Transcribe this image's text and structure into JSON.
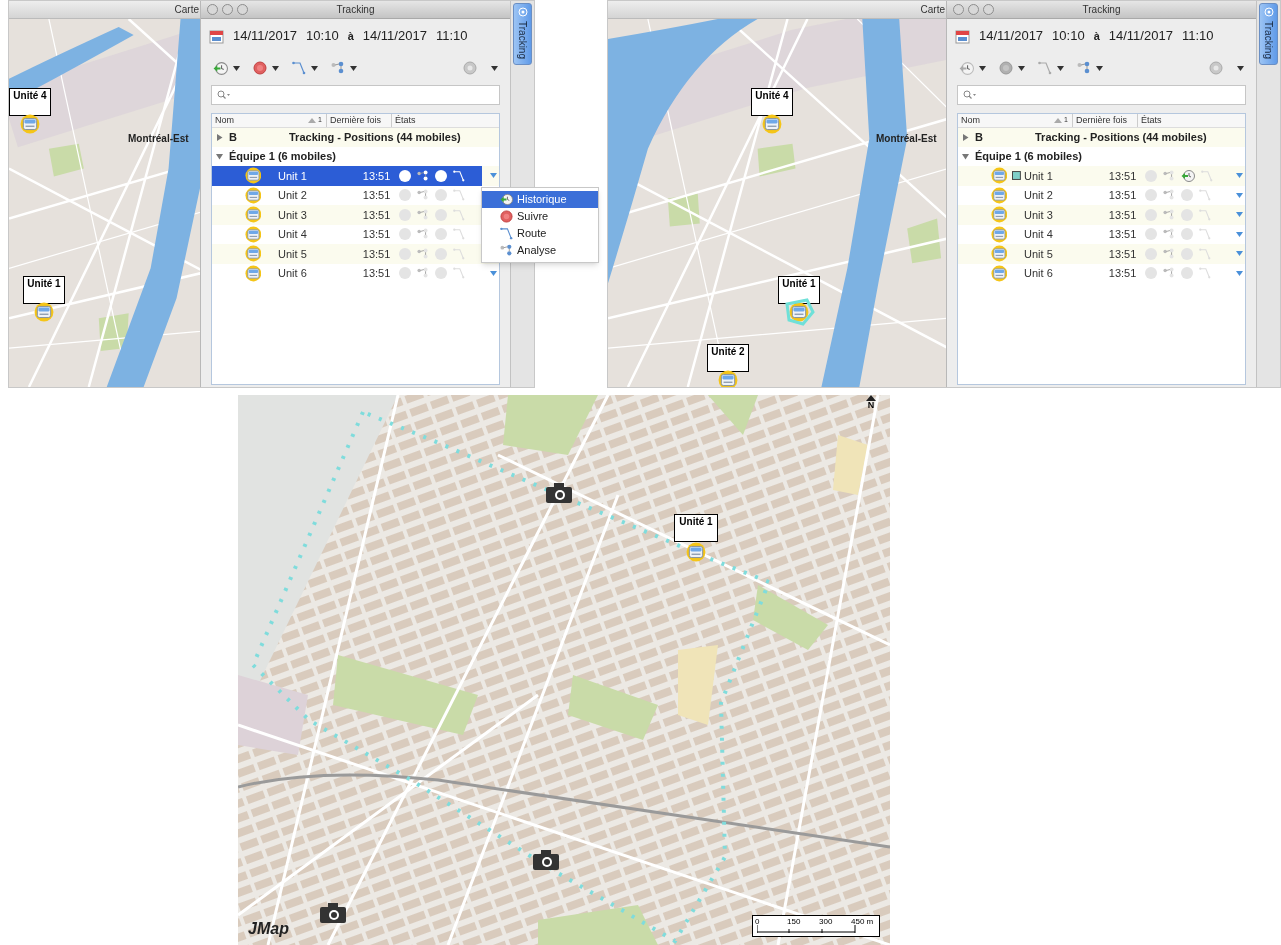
{
  "views": [
    {
      "map": {
        "title": "Carte",
        "place_labels": [
          "Montréal-Est"
        ],
        "markers": [
          {
            "label": "Unité 4",
            "highlighted": false
          },
          {
            "label": "Unité 1",
            "highlighted": false
          }
        ]
      },
      "tracking": {
        "title": "Tracking",
        "date_from": "14/11/2017",
        "time_from": "10:10",
        "separator": "à",
        "date_to": "14/11/2017",
        "time_to": "11:10",
        "toolbar_enabled": true,
        "columns": [
          "Nom",
          "Dernière fois",
          "États"
        ],
        "sort_rank": "1",
        "groups": [
          {
            "code": "B",
            "title": "Tracking - Positions (44 mobiles)",
            "expanded": false
          },
          {
            "title": "Équipe 1 (6 mobiles)",
            "expanded": true,
            "children": [
              {
                "name": "Unit 1",
                "time": "13:51",
                "selected": true,
                "tracked": false,
                "history": false
              },
              {
                "name": "Unit 2",
                "time": "13:51",
                "selected": false,
                "tracked": false,
                "history": false
              },
              {
                "name": "Unit 3",
                "time": "13:51",
                "selected": false,
                "tracked": false,
                "history": false
              },
              {
                "name": "Unit 4",
                "time": "13:51",
                "selected": false,
                "tracked": false,
                "history": false
              },
              {
                "name": "Unit 5",
                "time": "13:51",
                "selected": false,
                "tracked": false,
                "history": false
              },
              {
                "name": "Unit 6",
                "time": "13:51",
                "selected": false,
                "tracked": false,
                "history": false
              }
            ]
          }
        ],
        "menu": {
          "items": [
            {
              "label": "Historique",
              "kind": "history",
              "selected": true
            },
            {
              "label": "Suivre",
              "kind": "follow",
              "selected": false
            },
            {
              "label": "Route",
              "kind": "route",
              "selected": false
            },
            {
              "label": "Analyse",
              "kind": "analysis",
              "selected": false
            }
          ]
        }
      },
      "side_tab": "Tracking"
    },
    {
      "map": {
        "title": "Carte",
        "place_labels": [
          "Montréal-Est"
        ],
        "markers": [
          {
            "label": "Unité 4",
            "highlighted": false
          },
          {
            "label": "Unité 1",
            "highlighted": true
          },
          {
            "label": "Unité 2",
            "highlighted": false
          }
        ]
      },
      "tracking": {
        "title": "Tracking",
        "date_from": "14/11/2017",
        "time_from": "10:10",
        "separator": "à",
        "date_to": "14/11/2017",
        "time_to": "11:10",
        "toolbar_enabled": false,
        "columns": [
          "Nom",
          "Dernière fois",
          "États"
        ],
        "sort_rank": "1",
        "groups": [
          {
            "code": "B",
            "title": "Tracking - Positions (44 mobiles)",
            "expanded": false
          },
          {
            "title": "Équipe 1 (6 mobiles)",
            "expanded": true,
            "children": [
              {
                "name": "Unit 1",
                "time": "13:51",
                "selected": false,
                "tracked": true,
                "history": true
              },
              {
                "name": "Unit 2",
                "time": "13:51",
                "selected": false,
                "tracked": false,
                "history": false
              },
              {
                "name": "Unit 3",
                "time": "13:51",
                "selected": false,
                "tracked": false,
                "history": false
              },
              {
                "name": "Unit 4",
                "time": "13:51",
                "selected": false,
                "tracked": false,
                "history": false
              },
              {
                "name": "Unit 5",
                "time": "13:51",
                "selected": false,
                "tracked": false,
                "history": false
              },
              {
                "name": "Unit 6",
                "time": "13:51",
                "selected": false,
                "tracked": false,
                "history": false
              }
            ]
          }
        ]
      },
      "side_tab": "Tracking"
    }
  ],
  "detail_map": {
    "markers": [
      {
        "label": "Unité 1"
      }
    ],
    "north": "N",
    "logo": "JMap",
    "scale": [
      "0",
      "150",
      "300",
      "450 m"
    ]
  }
}
